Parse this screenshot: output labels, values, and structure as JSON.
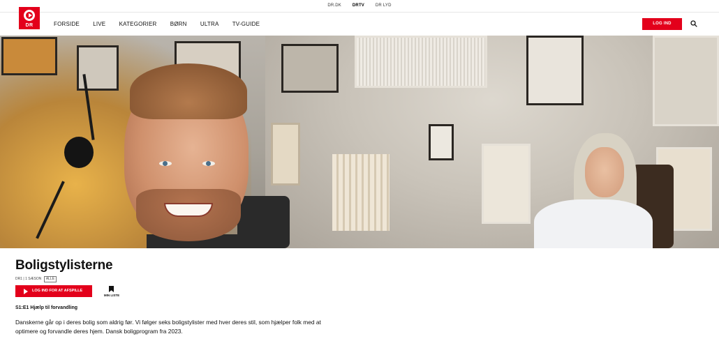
{
  "topbar": {
    "links": [
      {
        "label": "DR.DK",
        "active": false
      },
      {
        "label": "DRTV",
        "active": true
      },
      {
        "label": "DR LYD",
        "active": false
      }
    ]
  },
  "header": {
    "logo_text": "DR",
    "nav": [
      "FORSIDE",
      "LIVE",
      "KATEGORIER",
      "BØRN",
      "ULTRA",
      "TV-GUIDE"
    ],
    "login_label": "LOG IND",
    "search_icon": "search-icon",
    "accent_color": "#e3001b"
  },
  "hero": {
    "image": "promo-photo-two-hosts"
  },
  "program": {
    "title": "Boligstylisterne",
    "meta": "DR1 | 1 SÆSON",
    "rating_badge": "ALLE",
    "play_label": "LOG IND FOR AT AFSPILLE",
    "mylist_label": "MIN LISTE",
    "episode": "S1:E1 Hjælp til forvandling",
    "description": "Danskerne går op i deres bolig som aldrig før. Vi følger seks boligstylister med hver deres stil, som hjælper folk med at optimere og forvandle deres hjem. Dansk boligprogram fra 2023."
  }
}
